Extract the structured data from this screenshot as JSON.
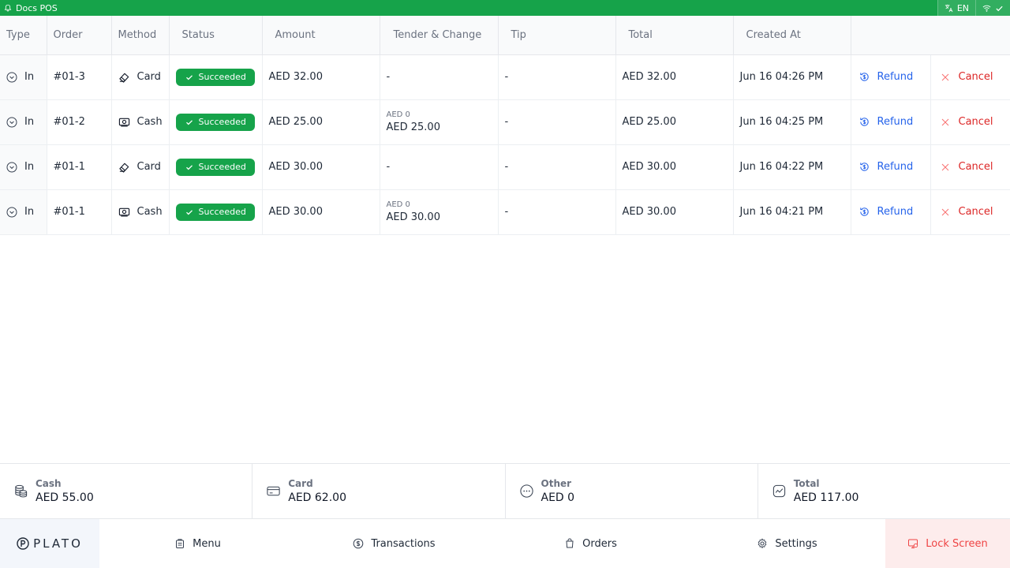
{
  "app": {
    "title": "Docs POS",
    "language": "EN"
  },
  "table": {
    "headers": [
      "Type",
      "Order",
      "Method",
      "Status",
      "Amount",
      "Tender & Change",
      "Tip",
      "Total",
      "Created At",
      ""
    ],
    "rows": [
      {
        "type": "In",
        "order": "#01-3",
        "method": "Card",
        "status": "Succeeded",
        "amount": "AED 32.00",
        "tender_small": "",
        "tender": "-",
        "tip": "-",
        "total": "AED 32.00",
        "created": "Jun 16 04:26 PM",
        "refund": "Refund",
        "cancel": "Cancel"
      },
      {
        "type": "In",
        "order": "#01-2",
        "method": "Cash",
        "status": "Succeeded",
        "amount": "AED 25.00",
        "tender_small": "AED 0",
        "tender": "AED 25.00",
        "tip": "-",
        "total": "AED 25.00",
        "created": "Jun 16 04:25 PM",
        "refund": "Refund",
        "cancel": "Cancel"
      },
      {
        "type": "In",
        "order": "#01-1",
        "method": "Card",
        "status": "Succeeded",
        "amount": "AED 30.00",
        "tender_small": "",
        "tender": "-",
        "tip": "-",
        "total": "AED 30.00",
        "created": "Jun 16 04:22 PM",
        "refund": "Refund",
        "cancel": "Cancel"
      },
      {
        "type": "In",
        "order": "#01-1",
        "method": "Cash",
        "status": "Succeeded",
        "amount": "AED 30.00",
        "tender_small": "AED 0",
        "tender": "AED 30.00",
        "tip": "-",
        "total": "AED 30.00",
        "created": "Jun 16 04:21 PM",
        "refund": "Refund",
        "cancel": "Cancel"
      }
    ]
  },
  "summary": [
    {
      "label": "Cash",
      "value": "AED 55.00",
      "icon": "coins-icon"
    },
    {
      "label": "Card",
      "value": "AED 62.00",
      "icon": "credit-card-icon"
    },
    {
      "label": "Other",
      "value": "AED 0",
      "icon": "more-circle-icon"
    },
    {
      "label": "Total",
      "value": "AED 117.00",
      "icon": "chart-icon"
    }
  ],
  "nav": {
    "logo": "PLATO",
    "items": [
      {
        "label": "Menu",
        "icon": "menu-icon"
      },
      {
        "label": "Transactions",
        "icon": "transactions-icon"
      },
      {
        "label": "Orders",
        "icon": "orders-icon"
      },
      {
        "label": "Settings",
        "icon": "settings-icon"
      }
    ],
    "lock": "Lock Screen"
  },
  "colors": {
    "brand": "#16a34a",
    "refund": "#2563eb",
    "cancel": "#dc2626",
    "lock_bg": "#fdecec"
  }
}
